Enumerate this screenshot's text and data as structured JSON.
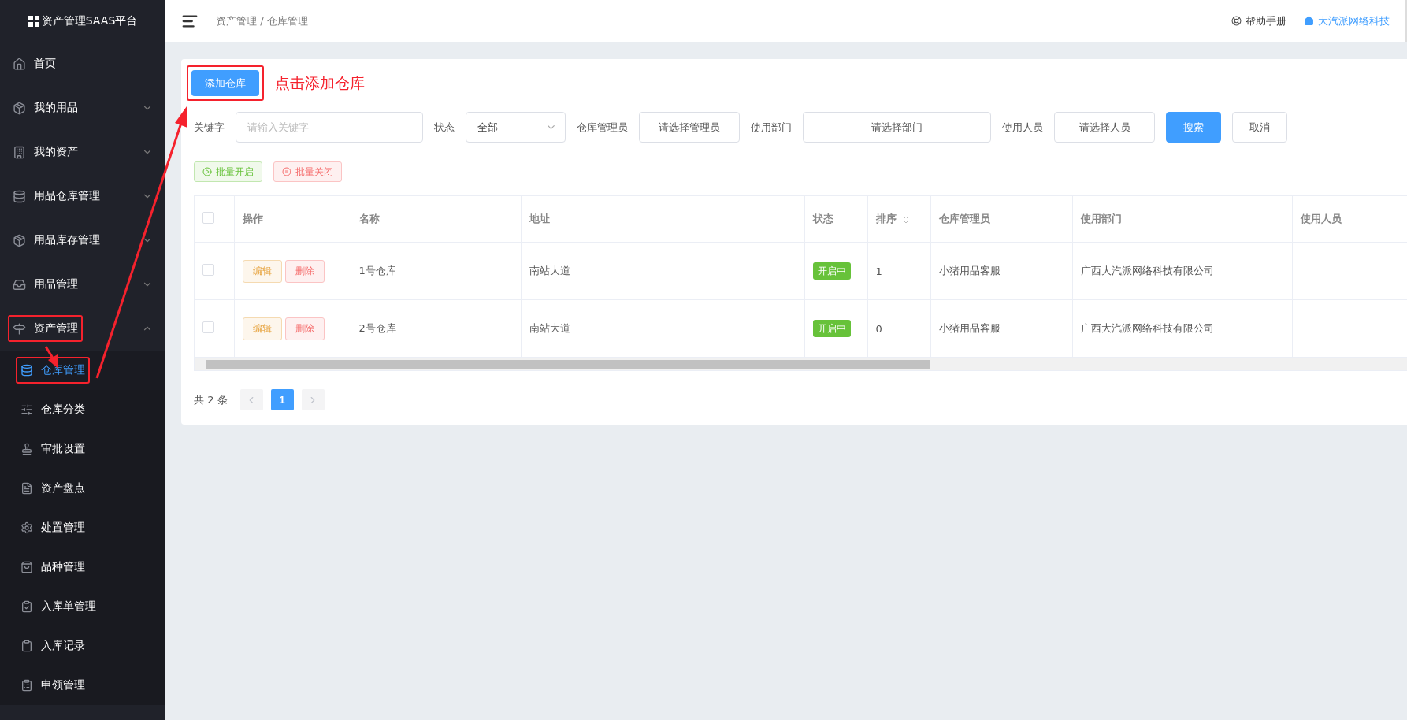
{
  "logo": {
    "title": "资产管理SAAS平台"
  },
  "sidebar": {
    "items": [
      {
        "label": "首页",
        "kind": "link"
      },
      {
        "label": "我的用品",
        "kind": "group",
        "expanded": false
      },
      {
        "label": "我的资产",
        "kind": "group",
        "expanded": false
      },
      {
        "label": "用品仓库管理",
        "kind": "group",
        "expanded": false
      },
      {
        "label": "用品库存管理",
        "kind": "group",
        "expanded": false
      },
      {
        "label": "用品管理",
        "kind": "group",
        "expanded": false
      },
      {
        "label": "资产管理",
        "kind": "group",
        "expanded": true,
        "highlighted": true,
        "children": [
          {
            "label": "仓库管理",
            "selected": true,
            "highlighted": true
          },
          {
            "label": "仓库分类",
            "selected": false,
            "highlighted": false
          },
          {
            "label": "审批设置",
            "selected": false,
            "highlighted": false
          },
          {
            "label": "资产盘点",
            "selected": false,
            "highlighted": false
          },
          {
            "label": "处置管理",
            "selected": false,
            "highlighted": false
          },
          {
            "label": "品种管理",
            "selected": false,
            "highlighted": false
          },
          {
            "label": "入库单管理",
            "selected": false,
            "highlighted": false
          },
          {
            "label": "入库记录",
            "selected": false,
            "highlighted": false
          },
          {
            "label": "申领管理",
            "selected": false,
            "highlighted": false
          }
        ]
      }
    ]
  },
  "header": {
    "breadcrumb": "资产管理 / 仓库管理",
    "links": [
      {
        "label": "帮助手册",
        "kind": "help"
      },
      {
        "label": "大汽派网络科技",
        "kind": "company"
      }
    ]
  },
  "toolbar": {
    "add_button": {
      "label": "添加仓库",
      "highlighted": true
    },
    "annotation": "点击添加仓库"
  },
  "filters": [
    {
      "label": "关键字",
      "kind": "input",
      "placeholder": "请输入关键字"
    },
    {
      "label": "状态",
      "kind": "select",
      "value": "全部"
    },
    {
      "label": "仓库管理员",
      "kind": "picker",
      "text": "请选择管理员"
    },
    {
      "label": "使用部门",
      "kind": "picker",
      "text": "请选择部门",
      "wide": true
    },
    {
      "label": "使用人员",
      "kind": "picker",
      "text": "请选择人员"
    }
  ],
  "filter_actions": [
    {
      "label": "搜索",
      "kind": "primary"
    },
    {
      "label": "取消",
      "kind": "plain"
    }
  ],
  "batch_actions": [
    {
      "label": "批量开启",
      "kind": "enable"
    },
    {
      "label": "批量关闭",
      "kind": "disable"
    }
  ],
  "table": {
    "all_checked": false,
    "columns": [
      {
        "label": "操作"
      },
      {
        "label": "名称"
      },
      {
        "label": "地址"
      },
      {
        "label": "状态"
      },
      {
        "label": "排序",
        "sortable": true
      },
      {
        "label": "仓库管理员"
      },
      {
        "label": "使用部门"
      },
      {
        "label": "使用人员"
      }
    ],
    "rows": [
      {
        "checked": false,
        "actions": [
          "编辑",
          "删除"
        ],
        "name": "1号仓库",
        "address": "南站大道",
        "status": "开启中",
        "order": "1",
        "manager": "小猪用品客服",
        "department": "广西大汽派网络科技有限公司"
      },
      {
        "checked": false,
        "actions": [
          "编辑",
          "删除"
        ],
        "name": "2号仓库",
        "address": "南站大道",
        "status": "开启中",
        "order": "0",
        "manager": "小猪用品客服",
        "department": "广西大汽派网络科技有限公司"
      }
    ]
  },
  "pagination": {
    "total": "共 2 条",
    "pages": [
      {
        "label": "1",
        "selected": true
      }
    ]
  }
}
